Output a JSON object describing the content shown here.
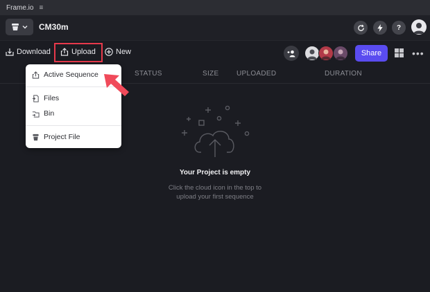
{
  "titlebar": {
    "app_name": "Frame.io",
    "menu_glyph": "≡"
  },
  "header": {
    "project_title": "CM30m",
    "icons": [
      "refresh-icon",
      "lightning-icon",
      "help-icon",
      "user-avatar"
    ],
    "help_glyph": "?"
  },
  "toolbar": {
    "download_label": "Download",
    "upload_label": "Upload",
    "new_label": "New",
    "share_label": "Share"
  },
  "columns": [
    "STATUS",
    "SIZE",
    "UPLOADED",
    "DURATION"
  ],
  "upload_menu": {
    "items": [
      {
        "label": "Active Sequence",
        "icon": "share-upload-icon"
      },
      {
        "label": "Files",
        "icon": "files-icon"
      },
      {
        "label": "Bin",
        "icon": "bin-icon"
      },
      {
        "label": "Project File",
        "icon": "premiere-icon"
      }
    ]
  },
  "empty_state": {
    "title": "Your Project is empty",
    "subtitle_line1": "Click the cloud icon in the top to",
    "subtitle_line2": "upload your first sequence"
  },
  "colors": {
    "background": "#1b1c22",
    "accent": "#5a4cf0",
    "highlight": "#e8394b",
    "annotation_arrow": "#f04a5a"
  }
}
